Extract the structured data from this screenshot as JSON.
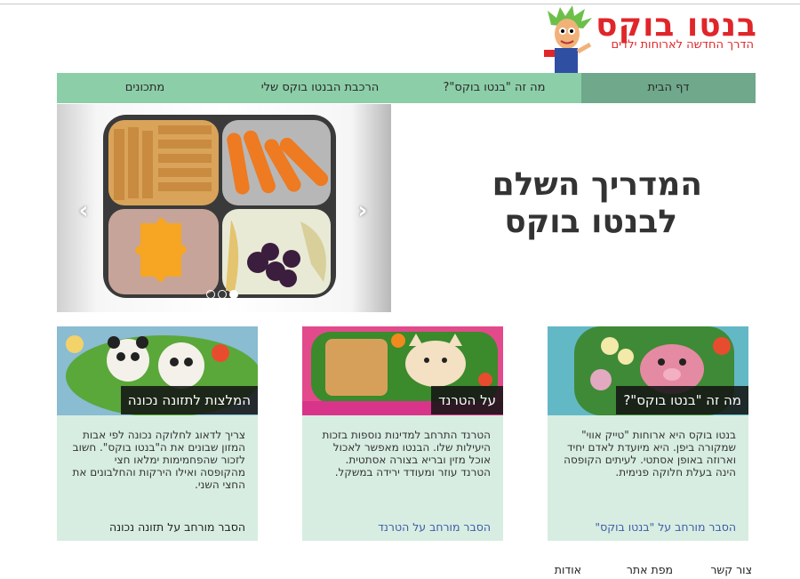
{
  "logo": {
    "title": "בנטו בוקס",
    "subtitle": "הדרך החדשה לארוחות ילדים"
  },
  "nav": {
    "items": [
      {
        "label": "דף הבית"
      },
      {
        "label": "מה זה \"בנטו בוקס\"?"
      },
      {
        "label": "הרכבת הבנטו בוקס שלי"
      },
      {
        "label": "מתכונים"
      }
    ]
  },
  "slider": {
    "prev_symbol": "‹",
    "next_symbol": "›",
    "slide_count": 3,
    "active_slide": 3
  },
  "headline": {
    "line1": "המדריך השלם",
    "line2": "לבנטו בוקס"
  },
  "cards": [
    {
      "label": "מה זה \"בנטו בוקס\"?",
      "text": "בנטו בוקס היא ארוחות \"טייק אווי\" שמקורה ביפן. היא מיועדת לאדם יחיד וארוזה באופן אסתטי. לעיתים הקופסה הינה בעלת חלוקה פנימית.",
      "link": "הסבר מורחב על \"בנטו בוקס\""
    },
    {
      "label": "על הטרנד",
      "text": "הטרנד התרחב למדינות נוספות בזכות היעילות שלו. הבנטו מאפשר לאכול אוכל מזין ובריא בצורה אסתטית. הטרנד עוזר ומעודד ירידה במשקל.",
      "link": "הסבר מורחב על הטרנד"
    },
    {
      "label": "המלצות לתזונה נכונה",
      "text": "צריך לדאוג לחלוקה נכונה לפי אבות המזון שבונים את ה\"בנטו בוקס\". חשוב לזכור שהפחמימות ימלאו חצי מהקופסה ואילו הירקות והחלבונים את החצי השני.",
      "link": "הסבר מורחב על תזונה נכונה"
    }
  ],
  "footer": {
    "links": [
      {
        "label": "צור קשר"
      },
      {
        "label": "מפת אתר"
      },
      {
        "label": "אודות"
      }
    ]
  },
  "colors": {
    "nav_bg": "#8ccea8",
    "nav_active": "#6fa88a",
    "card_bg": "#d7ede1",
    "brand_red": "#e0262a",
    "link_blue": "#3e5ba9"
  }
}
